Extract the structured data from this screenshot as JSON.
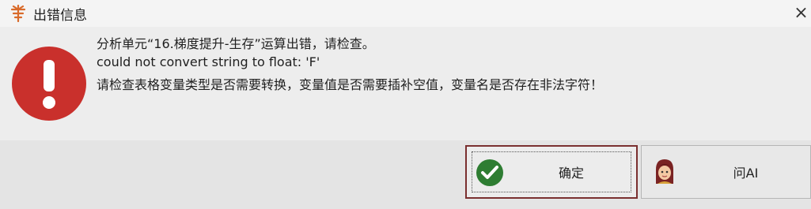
{
  "window": {
    "title": "出错信息",
    "close_symbol": "×"
  },
  "message": {
    "line1": "分析单元“16.梯度提升-生存”运算出错，请检查。",
    "line2": "could not convert string to float: 'F'",
    "line3": "请检查表格变量类型是否需要转换，变量值是否需要插补空值，变量名是否存在非法字符！"
  },
  "buttons": {
    "ok_label": "确定",
    "ask_ai_label": "问AI"
  },
  "icons": {
    "title": "app-logo-icon",
    "error": "exclamation-icon",
    "ok": "check-circle-icon",
    "ai": "ai-assistant-avatar-icon"
  },
  "colors": {
    "error_red": "#c9302c",
    "ok_green": "#2e7d32",
    "focus_border": "#7a2f2f"
  }
}
